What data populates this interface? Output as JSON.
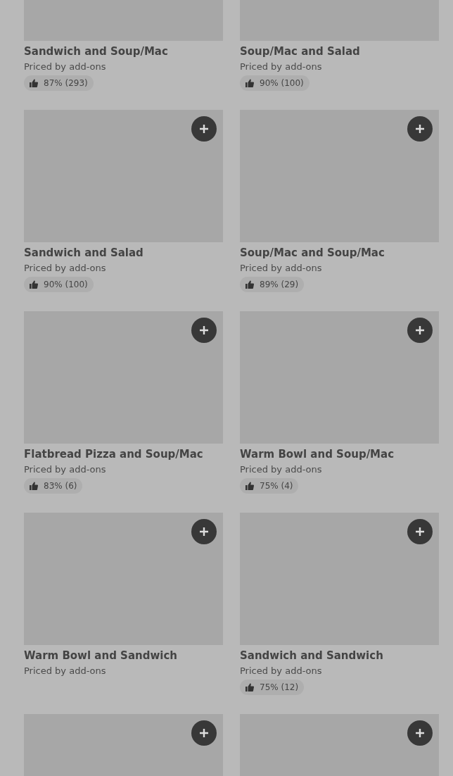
{
  "cards": [
    {
      "title": "Sandwich and Soup/Mac",
      "subtitle": "Priced by add-ons",
      "rating": "87% (293)",
      "add_button": false
    },
    {
      "title": "Soup/Mac and Salad",
      "subtitle": "Priced by add-ons",
      "rating": "90% (100)",
      "add_button": false
    },
    {
      "title": "Sandwich and Salad",
      "subtitle": "Priced by add-ons",
      "rating": "90% (100)",
      "add_button": true
    },
    {
      "title": "Soup/Mac and Soup/Mac",
      "subtitle": "Priced by add-ons",
      "rating": "89% (29)",
      "add_button": true
    },
    {
      "title": "Flatbread Pizza and Soup/Mac",
      "subtitle": "Priced by add-ons",
      "rating": "83% (6)",
      "add_button": true
    },
    {
      "title": "Warm Bowl and Soup/Mac",
      "subtitle": "Priced by add-ons",
      "rating": "75% (4)",
      "add_button": true
    },
    {
      "title": "Warm Bowl and Sandwich",
      "subtitle": "Priced by add-ons",
      "add_button": true
    },
    {
      "title": "Sandwich and Sandwich",
      "subtitle": "Priced by add-ons",
      "rating": "75% (12)",
      "add_button": true
    },
    {
      "add_button": true
    },
    {
      "add_button": true
    }
  ]
}
